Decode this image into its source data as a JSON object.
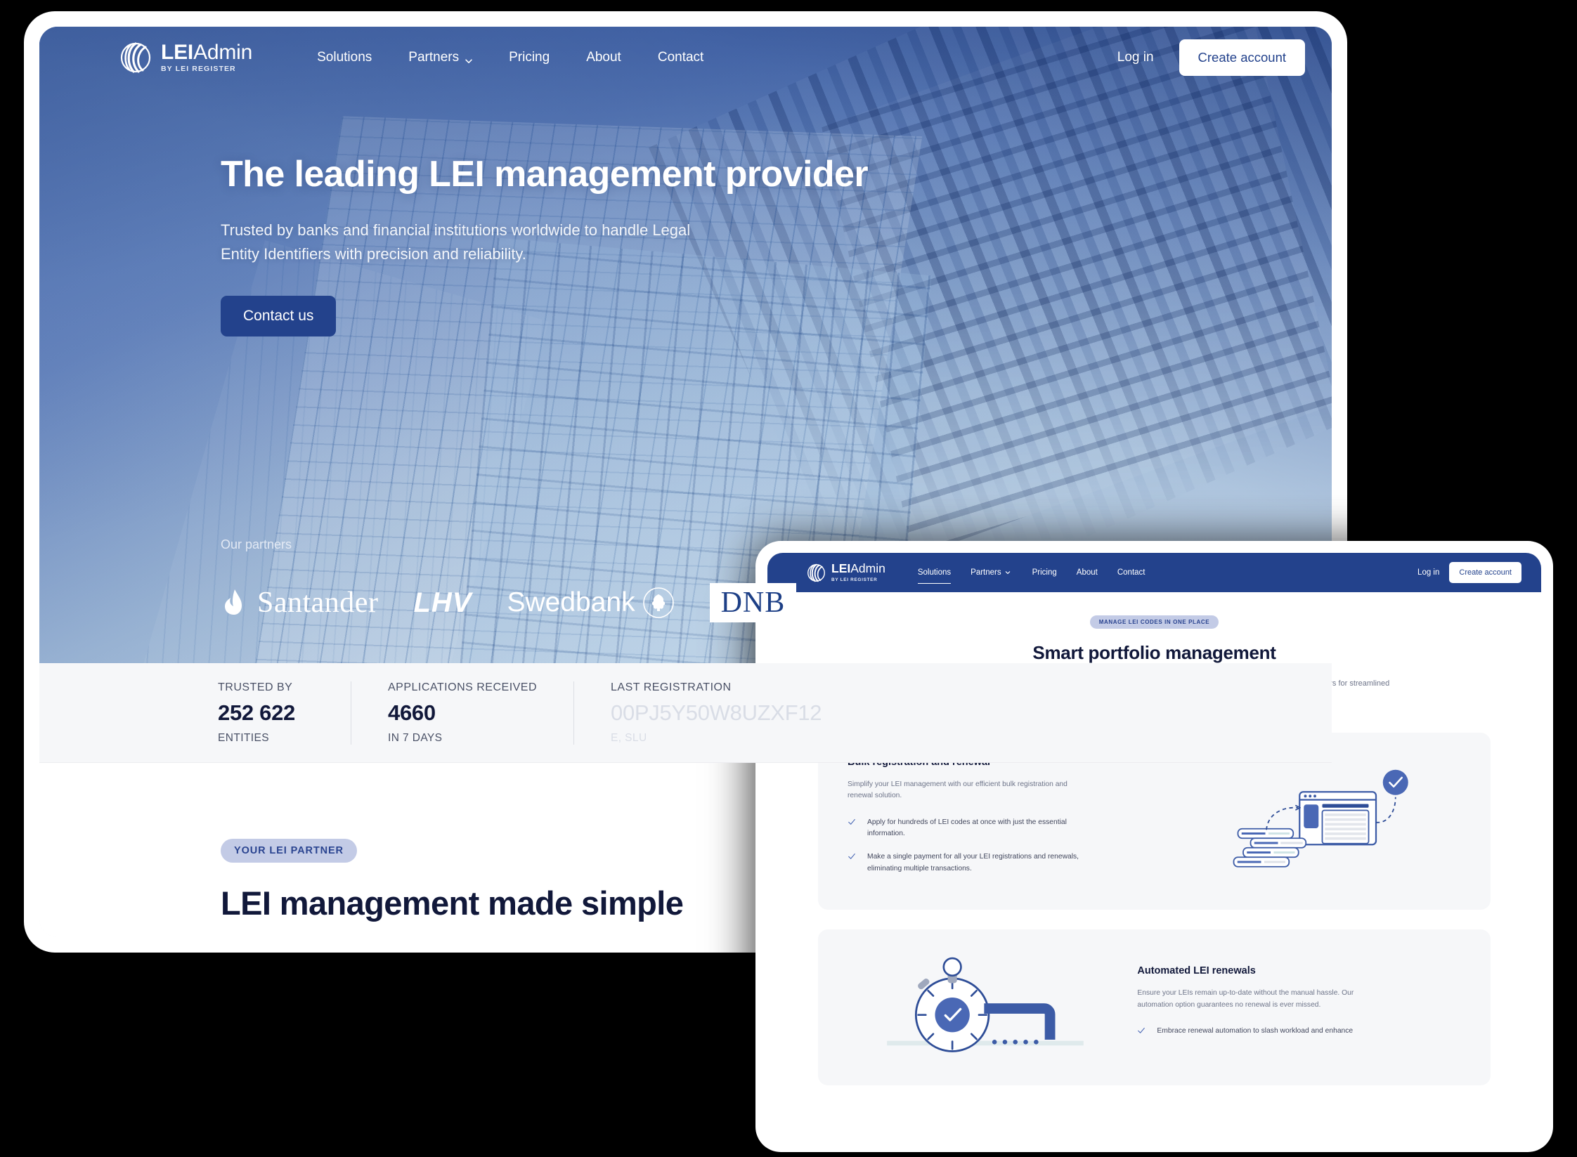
{
  "brand": {
    "name_bold": "LEI",
    "name_light": "Admin",
    "tagline": "BY LEI REGISTER",
    "accent": "#23428c",
    "pill_bg": "#c3cbe6",
    "pill_text": "#2a4490"
  },
  "laptop": {
    "nav": {
      "links": [
        {
          "label": "Solutions",
          "has_chevron": false
        },
        {
          "label": "Partners",
          "has_chevron": true
        },
        {
          "label": "Pricing",
          "has_chevron": false
        },
        {
          "label": "About",
          "has_chevron": false
        },
        {
          "label": "Contact",
          "has_chevron": false
        }
      ],
      "login_label": "Log in",
      "create_account_label": "Create account"
    },
    "hero": {
      "heading": "The leading LEI management provider",
      "paragraph": "Trusted by banks and financial institutions worldwide to handle Legal Entity Identifiers with precision and reliability.",
      "cta_label": "Contact us"
    },
    "partners": {
      "label": "Our partners",
      "logos": [
        {
          "name": "Santander",
          "text": "Santander"
        },
        {
          "name": "LHV",
          "text": "LHV"
        },
        {
          "name": "Swedbank",
          "text": "Swedbank"
        },
        {
          "name": "DNB",
          "text": "DNB"
        }
      ]
    },
    "stats": [
      {
        "label": "TRUSTED BY",
        "value": "252 622",
        "sub": "ENTITIES",
        "faded": false
      },
      {
        "label": "APPLICATIONS RECEIVED",
        "value": "4660",
        "sub": "IN 7 DAYS",
        "faded": false
      },
      {
        "label": "LAST REGISTRATION",
        "value": "00PJ5Y50W8UZXF12",
        "sub": "E, SLU",
        "faded": true
      }
    ],
    "lower": {
      "pill": "YOUR LEI PARTNER",
      "heading": "LEI management made simple"
    }
  },
  "tablet": {
    "nav": {
      "links": [
        {
          "label": "Solutions",
          "has_chevron": false,
          "active": true
        },
        {
          "label": "Partners",
          "has_chevron": true,
          "active": false
        },
        {
          "label": "Pricing",
          "has_chevron": false,
          "active": false
        },
        {
          "label": "About",
          "has_chevron": false,
          "active": false
        },
        {
          "label": "Contact",
          "has_chevron": false,
          "active": false
        }
      ],
      "login_label": "Log in",
      "create_account_label": "Create account"
    },
    "section": {
      "pill": "MANAGE LEI CODES IN ONE PLACE",
      "heading": "Smart portfolio management",
      "subtitle": "Experience the ease of bulk LEI code registration, coupled with automated renewals, timely alerts, and seamless transfers for streamlined compliance."
    },
    "cards": [
      {
        "title": "Bulk registration and renewal",
        "body": "Simplify your LEI management with our efficient bulk registration and renewal solution.",
        "bullets": [
          "Apply for hundreds of LEI codes at once with just the essential information.",
          "Make a single payment for all your LEI registrations and renewals, eliminating multiple transactions."
        ]
      },
      {
        "title": "Automated LEI renewals",
        "body": "Ensure your LEIs remain up-to-date without the manual hassle. Our automation option guarantees no renewal is ever missed.",
        "bullets": [
          "Embrace renewal automation to slash workload and enhance"
        ]
      }
    ]
  }
}
